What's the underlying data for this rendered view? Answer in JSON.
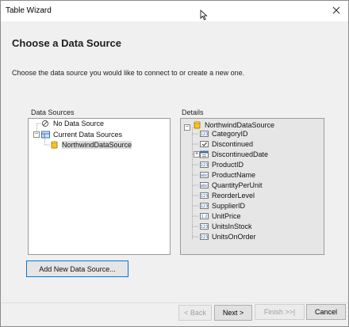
{
  "window": {
    "title": "Table Wizard"
  },
  "header": {
    "heading": "Choose a Data Source",
    "subheading": "Choose the data source you would like to connect to or create a new one."
  },
  "data_sources": {
    "label": "Data Sources",
    "items": [
      {
        "label": "No Data Source",
        "icon": "no-data-source-icon"
      },
      {
        "label": "Current Data Sources",
        "icon": "data-sources-icon"
      },
      {
        "label": "NorthwindDataSource",
        "icon": "database-icon",
        "selected": true
      }
    ]
  },
  "details": {
    "label": "Details",
    "root": "NorthwindDataSource",
    "fields": [
      {
        "label": "CategoryID",
        "icon": "numeric-field-icon"
      },
      {
        "label": "Discontinued",
        "icon": "boolean-field-icon"
      },
      {
        "label": "DiscontinuedDate",
        "icon": "date-field-icon",
        "expandable": true
      },
      {
        "label": "ProductID",
        "icon": "numeric-field-icon"
      },
      {
        "label": "ProductName",
        "icon": "text-field-icon"
      },
      {
        "label": "QuantityPerUnit",
        "icon": "text-field-icon"
      },
      {
        "label": "ReorderLevel",
        "icon": "numeric-field-icon"
      },
      {
        "label": "SupplierID",
        "icon": "numeric-field-icon"
      },
      {
        "label": "UnitPrice",
        "icon": "decimal-field-icon"
      },
      {
        "label": "UnitsInStock",
        "icon": "numeric-field-icon"
      },
      {
        "label": "UnitsOnOrder",
        "icon": "numeric-field-icon"
      }
    ]
  },
  "buttons": {
    "add_new": "Add New Data Source...",
    "back": "< Back",
    "next": "Next >",
    "finish": "Finish >>|",
    "cancel": "Cancel"
  },
  "colors": {
    "accent": "#0078d7",
    "background": "#f0f0f0",
    "db_yellow": "#e8b400"
  }
}
